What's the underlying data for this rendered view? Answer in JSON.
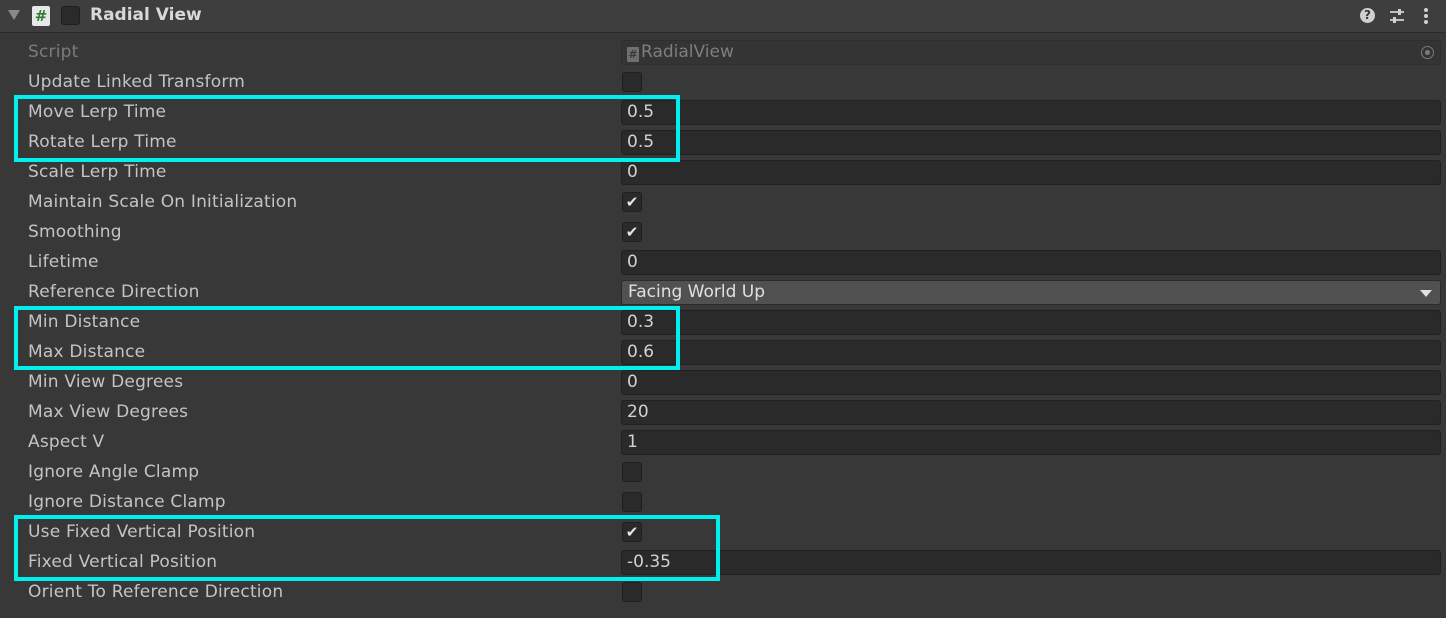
{
  "component": {
    "title": "Radial View",
    "script_icon": "script-hash-icon",
    "enabled": false
  },
  "header_icons": [
    "help-icon",
    "presets-icon",
    "context-menu-icon"
  ],
  "accent_color": "#00f0f0",
  "fields": {
    "script": {
      "label": "Script",
      "value": "RadialView",
      "object_icon_glyph": "#"
    },
    "update_linked_transform": {
      "label": "Update Linked Transform",
      "checked": false,
      "mark": ""
    },
    "move_lerp_time": {
      "label": "Move Lerp Time",
      "value": "0.5"
    },
    "rotate_lerp_time": {
      "label": "Rotate Lerp Time",
      "value": "0.5"
    },
    "scale_lerp_time": {
      "label": "Scale Lerp Time",
      "value": "0"
    },
    "maintain_scale": {
      "label": "Maintain Scale On Initialization",
      "checked": true,
      "mark": "✔"
    },
    "smoothing": {
      "label": "Smoothing",
      "checked": true,
      "mark": "✔"
    },
    "lifetime": {
      "label": "Lifetime",
      "value": "0"
    },
    "reference_direction": {
      "label": "Reference Direction",
      "selected": "Facing World Up"
    },
    "min_distance": {
      "label": "Min Distance",
      "value": "0.3"
    },
    "max_distance": {
      "label": "Max Distance",
      "value": "0.6"
    },
    "min_view_degrees": {
      "label": "Min View Degrees",
      "value": "0"
    },
    "max_view_degrees": {
      "label": "Max View Degrees",
      "value": "20"
    },
    "aspect_v": {
      "label": "Aspect V",
      "value": "1"
    },
    "ignore_angle_clamp": {
      "label": "Ignore Angle Clamp",
      "checked": false,
      "mark": ""
    },
    "ignore_distance_clamp": {
      "label": "Ignore Distance Clamp",
      "checked": false,
      "mark": ""
    },
    "use_fixed_vertical_position": {
      "label": "Use Fixed Vertical Position",
      "checked": true,
      "mark": "✔"
    },
    "fixed_vertical_position": {
      "label": "Fixed Vertical Position",
      "value": "-0.35"
    },
    "orient_to_reference_direction": {
      "label": "Orient To Reference Direction",
      "checked": false,
      "mark": ""
    }
  }
}
